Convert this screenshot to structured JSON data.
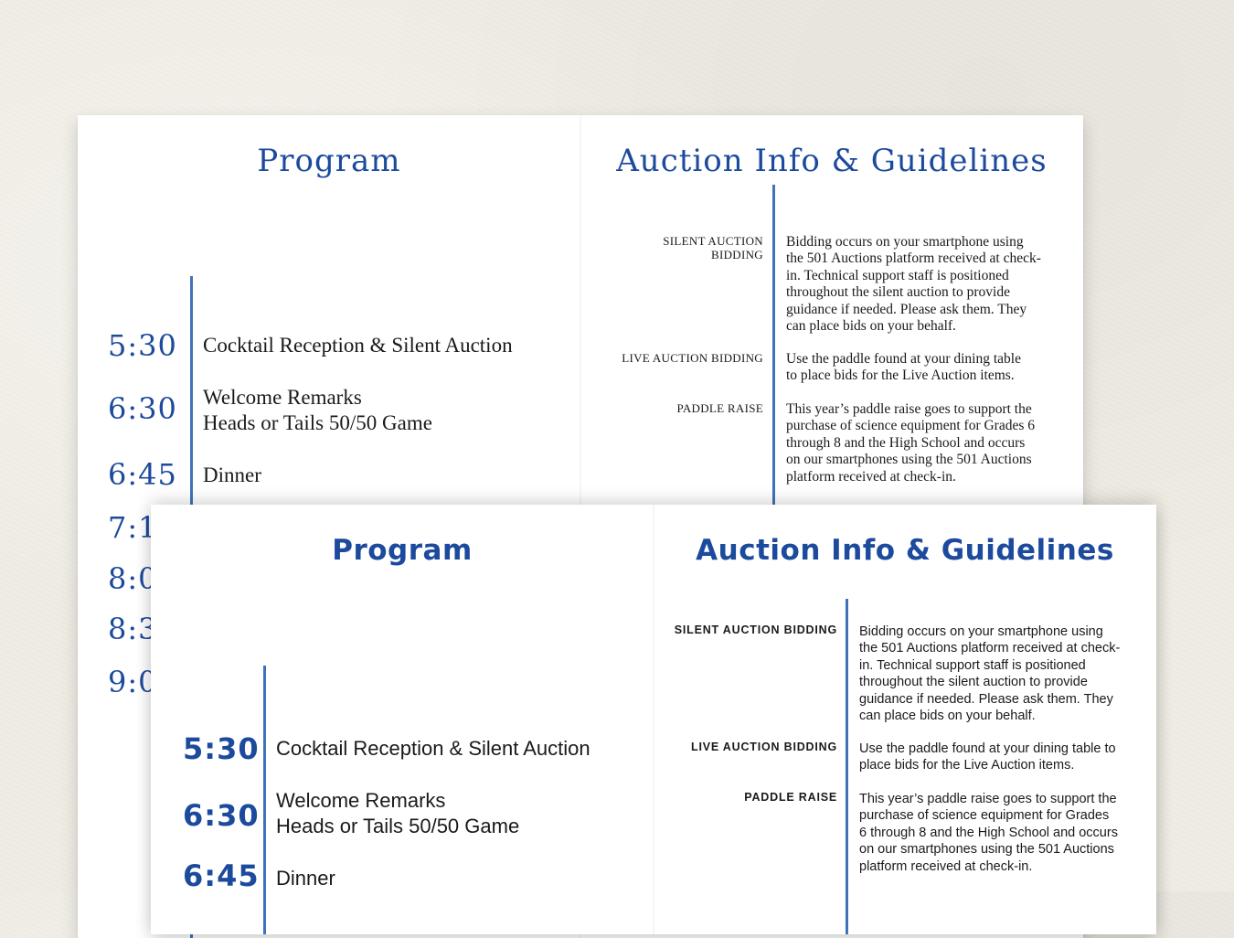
{
  "back_card": {
    "program_title": "Program",
    "auction_title": "Auction Info & Guidelines",
    "schedule": [
      {
        "time": "5:30",
        "lines": [
          "Cocktail Reception & Silent Auction"
        ]
      },
      {
        "time": "6:30",
        "lines": [
          "Welcome Remarks",
          "Heads or Tails 50/50 Game"
        ]
      },
      {
        "time": "6:45",
        "lines": [
          "Dinner"
        ]
      },
      {
        "time": "7:1"
      },
      {
        "time": "8:0"
      },
      {
        "time": "8:3"
      },
      {
        "time": "9:0"
      }
    ],
    "guidelines": [
      {
        "label_lines": [
          "SILENT AUCTION",
          "BIDDING"
        ],
        "lines": [
          "Bidding occurs on your smartphone using",
          "the 501 Auctions platform received at check-",
          "in.  Technical support staff is positioned",
          "throughout the silent auction to provide",
          "guidance if needed.  Please ask them. They",
          "can place bids on your behalf."
        ]
      },
      {
        "label_lines": [
          "LIVE AUCTION BIDDING"
        ],
        "lines": [
          "Use the paddle found at your dining table",
          "to place bids for the Live Auction items."
        ]
      },
      {
        "label_lines": [
          "PADDLE RAISE"
        ],
        "lines": [
          "This year’s paddle raise goes to support the",
          "purchase of science equipment for Grades 6",
          "through 8 and the High School and occurs",
          "on our smartphones using the 501 Auctions",
          "platform received at check-in."
        ]
      }
    ]
  },
  "front_card": {
    "program_title": "Program",
    "auction_title": "Auction Info & Guidelines",
    "schedule": [
      {
        "time": "5:30",
        "lines": [
          "Cocktail Reception & Silent Auction"
        ]
      },
      {
        "time": "6:30",
        "lines": [
          "Welcome Remarks",
          "Heads or Tails 50/50 Game"
        ]
      },
      {
        "time": "6:45",
        "lines": [
          "Dinner"
        ]
      }
    ],
    "guidelines": [
      {
        "label_lines": [
          "SILENT AUCTION BIDDING"
        ],
        "lines": [
          "Bidding occurs on your smartphone using",
          "the 501 Auctions platform received at check-",
          "in.  Technical support staff is positioned",
          "throughout the silent auction to provide",
          "guidance if needed.  Please ask them. They",
          "can place bids on your behalf."
        ]
      },
      {
        "label_lines": [
          "LIVE AUCTION BIDDING"
        ],
        "lines": [
          "Use the paddle found at your dining table to",
          "place bids for the Live Auction items."
        ]
      },
      {
        "label_lines": [
          "PADDLE RAISE"
        ],
        "lines": [
          "This year’s paddle raise goes to support the",
          "purchase of science equipment for Grades",
          "6 through 8 and the High School and occurs",
          "on our smartphones using the 501 Auctions",
          "platform received at check-in."
        ]
      }
    ]
  },
  "colors": {
    "accent_blue": "#1c4a9c",
    "rule_blue": "#3e73b9",
    "paper_background": "#efece4"
  }
}
